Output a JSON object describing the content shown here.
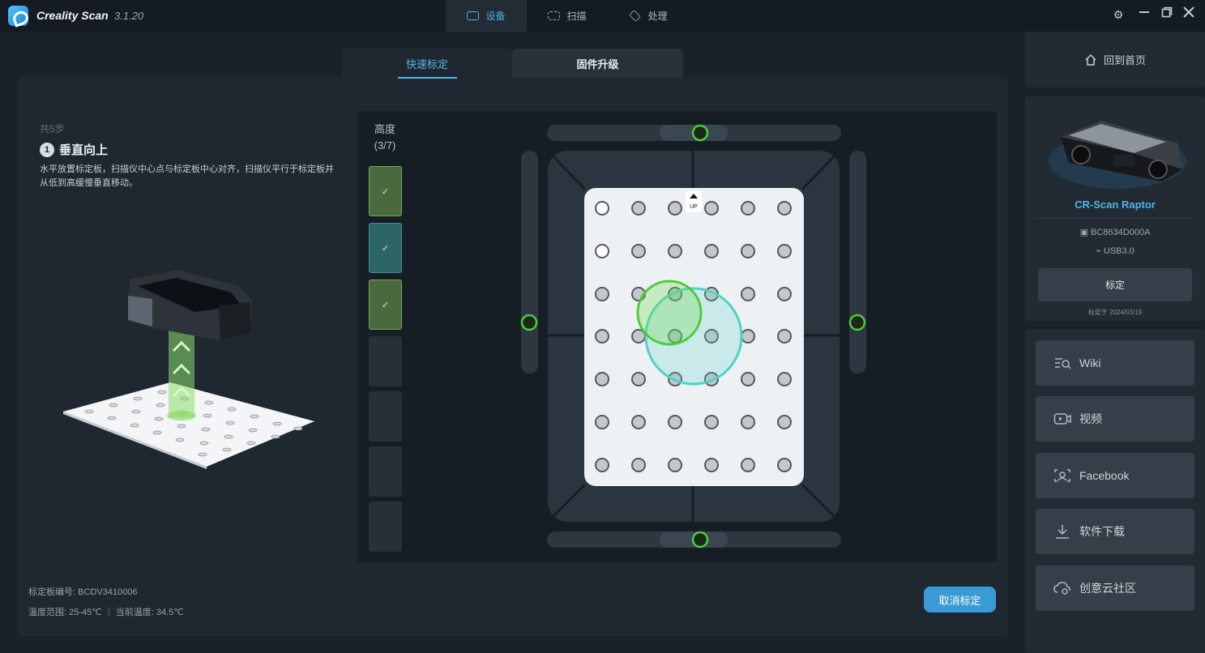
{
  "app": {
    "title": "Creality Scan",
    "version": "3.1.20"
  },
  "topnav": [
    {
      "label": "设备",
      "active": true,
      "icon": "device-icon"
    },
    {
      "label": "扫描",
      "active": false,
      "icon": "scan-icon"
    },
    {
      "label": "处理",
      "active": false,
      "icon": "layers-icon"
    }
  ],
  "window_controls": {
    "settings": "gear-icon",
    "minimize": "minimize-icon",
    "restore": "restore-icon",
    "close": "close-icon"
  },
  "subtabs": {
    "quick": "快速标定",
    "firmware": "固件升级"
  },
  "guide": {
    "steps_total": "共5步",
    "step_number": "1",
    "step_title": "垂直向上",
    "step_desc": "水平放置标定板，扫描仪中心点与标定板中心对齐，扫描仪平行于标定板并从低到高缓慢垂直移动。"
  },
  "board": {
    "id_line": "标定板编号: BCDV3410006",
    "temp_line": "温度范围: 25-45℃ ｜ 当前温度: 34.5℃"
  },
  "height": {
    "label": "高度",
    "progress": "(3/7)",
    "completed": 3,
    "total": 7,
    "check": "✓"
  },
  "target": {
    "up_label": "UP"
  },
  "cancel_label": "取消标定",
  "sidebar": {
    "home_label": "回到首页",
    "device_name": "CR-Scan Raptor",
    "serial": "BC8634D000A",
    "usb": "USB3.0",
    "calib_button": "标定",
    "calib_date": "标定于 2024/03/19",
    "links": [
      {
        "label": "Wiki",
        "icon": "wiki-search-icon"
      },
      {
        "label": "视频",
        "icon": "video-icon"
      },
      {
        "label": "Facebook",
        "icon": "facebook-icon"
      },
      {
        "label": "软件下载",
        "icon": "download-icon"
      },
      {
        "label": "创意云社区",
        "icon": "community-cloud-icon"
      }
    ]
  },
  "colors": {
    "accent": "#4fb7e8",
    "green": "#4ccc3a",
    "teal": "#4fd1c5",
    "panel": "#1f2831"
  }
}
